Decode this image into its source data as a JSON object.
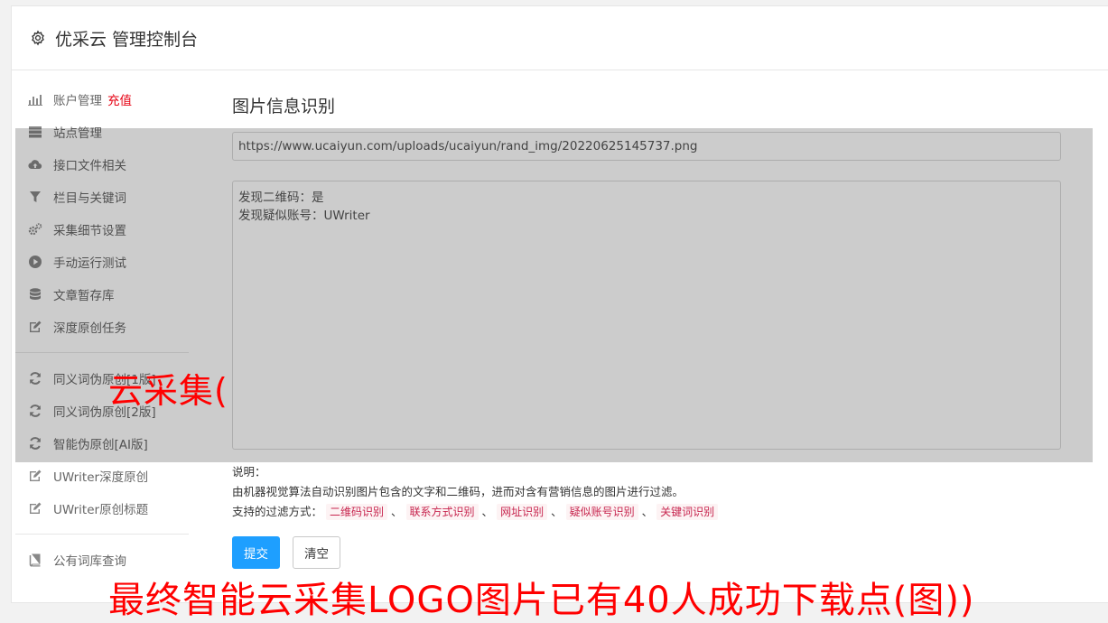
{
  "header": {
    "title": "优采云 管理控制台",
    "icon": "gear-icon"
  },
  "sidebar": {
    "group1": [
      {
        "label": "账户管理",
        "badge": "充值",
        "icon": "bar-chart-icon"
      },
      {
        "label": "站点管理",
        "icon": "server-icon"
      },
      {
        "label": "接口文件相关",
        "icon": "cloud-upload-icon"
      },
      {
        "label": "栏目与关键词",
        "icon": "filter-icon"
      },
      {
        "label": "采集细节设置",
        "icon": "gears-icon"
      },
      {
        "label": "手动运行测试",
        "icon": "play-circle-icon"
      },
      {
        "label": "文章暂存库",
        "icon": "database-icon"
      },
      {
        "label": "深度原创任务",
        "icon": "edit-icon"
      }
    ],
    "group2": [
      {
        "label": "同义词伪原创[1版]",
        "icon": "refresh-icon"
      },
      {
        "label": "同义词伪原创[2版]",
        "icon": "refresh-icon"
      },
      {
        "label": "智能伪原创[AI版]",
        "icon": "refresh-icon"
      },
      {
        "label": "UWriter深度原创",
        "icon": "edit-icon"
      },
      {
        "label": "UWriter原创标题",
        "icon": "edit-icon"
      }
    ],
    "group3": [
      {
        "label": "公有词库查询",
        "icon": "book-icon"
      }
    ]
  },
  "main": {
    "title": "图片信息识别",
    "url_value": "https://www.ucaiyun.com/uploads/ucaiyun/rand_img/20220625145737.png",
    "result_lines": [
      "发现二维码：是",
      "发现疑似账号：UWriter"
    ],
    "notes_label": "说明：",
    "notes_text": "由机器视觉算法自动识别图片包含的文字和二维码，进而对含有营销信息的图片进行过滤。",
    "filter_label": "支持的过滤方式：",
    "filters": [
      "二维码识别",
      "联系方式识别",
      "网址识别",
      "疑似账号识别",
      "关键词识别"
    ],
    "separator": "、",
    "submit_label": "提交",
    "clear_label": "清空"
  },
  "watermarks": {
    "line1": "云采集(",
    "line2": "最终智能云采集LOGO图片已有40人成功下载点(图))"
  },
  "colors": {
    "accent": "#1e9fff",
    "badge": "#e60012",
    "watermark": "#ff0000"
  }
}
